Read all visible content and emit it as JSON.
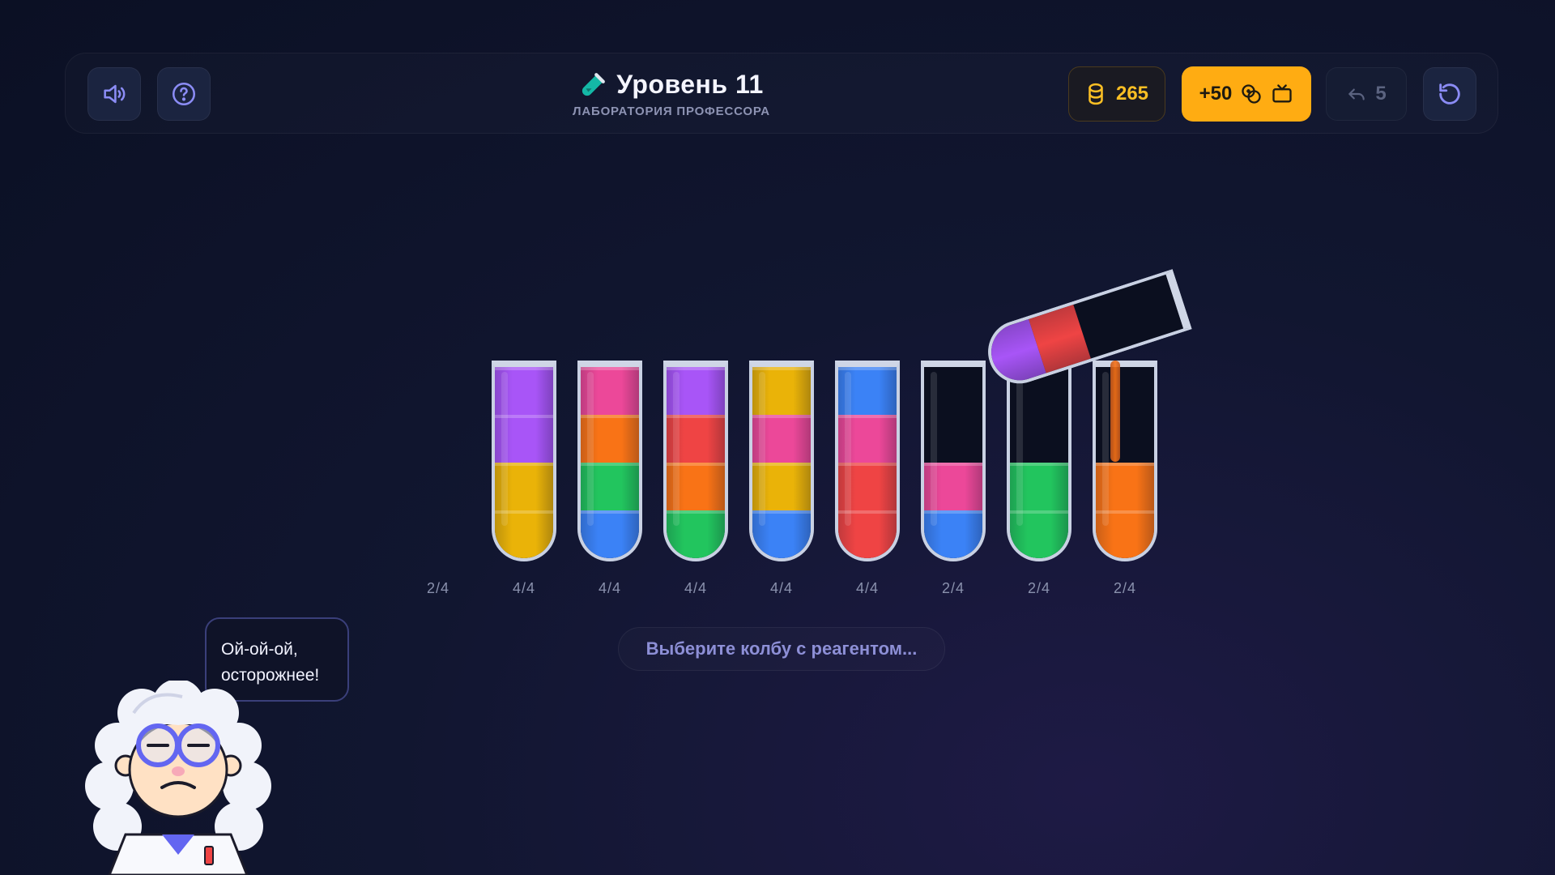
{
  "header": {
    "sound_icon": "speaker-icon",
    "help_icon": "question-icon",
    "level_icon": "test-tube-icon",
    "title": "Уровень 11",
    "subtitle": "ЛАБОРАТОРИЯ ПРОФЕССОРА",
    "coins": "265",
    "coin_icon": "coin-icon",
    "ad_reward_label": "+50",
    "ad_icons": [
      "coins-icon",
      "tv-icon"
    ],
    "undo_count": "5",
    "undo_icon": "undo-icon",
    "restart_icon": "restart-icon"
  },
  "colors": {
    "purple": "#a855f7",
    "yellow": "#eab308",
    "pink": "#ec4899",
    "orange": "#f97316",
    "green": "#22c55e",
    "blue": "#3b82f6",
    "red": "#ef4444",
    "accent": "#ffac12"
  },
  "tubes": [
    {
      "label": "4/4",
      "layers_top_to_bottom": [
        "purple",
        "purple",
        "yellow",
        "yellow"
      ]
    },
    {
      "label": "4/4",
      "layers_top_to_bottom": [
        "pink",
        "orange",
        "green",
        "blue"
      ]
    },
    {
      "label": "4/4",
      "layers_top_to_bottom": [
        "purple",
        "red",
        "orange",
        "green"
      ]
    },
    {
      "label": "4/4",
      "layers_top_to_bottom": [
        "yellow",
        "pink",
        "yellow",
        "blue"
      ]
    },
    {
      "label": "4/4",
      "layers_top_to_bottom": [
        "blue",
        "pink",
        "red",
        "red"
      ]
    },
    {
      "label": "2/4",
      "layers_top_to_bottom": [
        "empty",
        "empty",
        "pink",
        "blue"
      ]
    },
    {
      "label": "2/4",
      "layers_top_to_bottom": [
        "empty",
        "empty",
        "green",
        "green"
      ]
    },
    {
      "label": "2/4",
      "layers_top_to_bottom": [
        "empty",
        "empty",
        "orange",
        "orange"
      ]
    }
  ],
  "held_tube": {
    "label": "2/4",
    "layers_bottom_to_top": [
      "purple",
      "red",
      "empty",
      "empty"
    ]
  },
  "status": "Выберите колбу с реагентом...",
  "speech": {
    "line1": "Ой-ой-ой,",
    "line2": "осторожнее!"
  }
}
